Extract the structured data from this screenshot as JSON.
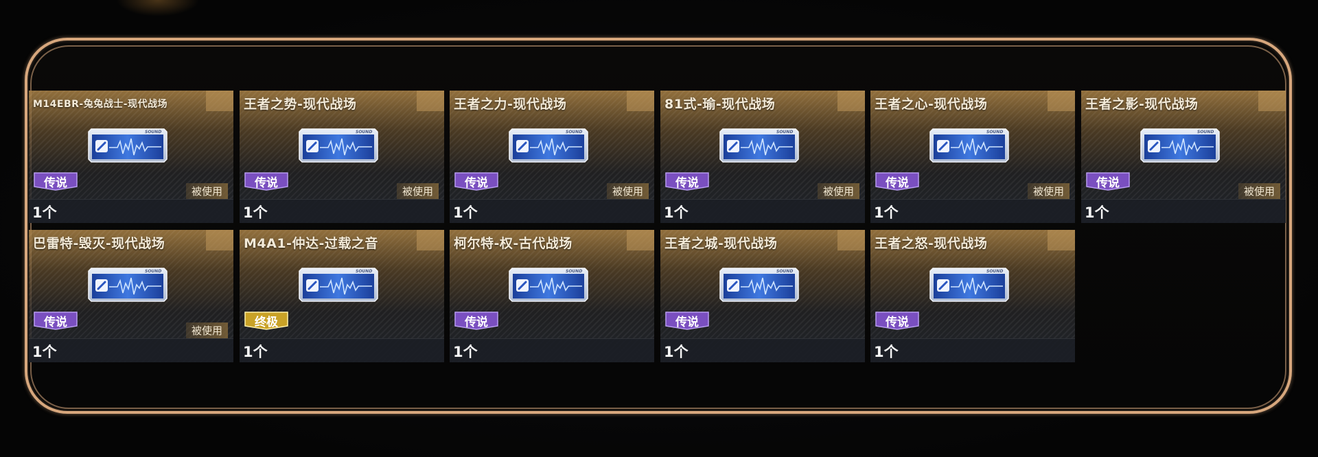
{
  "cards": [
    {
      "title": "M14EBR-兔兔战士-现代战场",
      "rarity": "传说",
      "rarity_color": "#7a4fc0",
      "status": "被使用",
      "count": "1个",
      "icon": "sound-ticket-icon"
    },
    {
      "title": "王者之势-现代战场",
      "rarity": "传说",
      "rarity_color": "#7a4fc0",
      "status": "被使用",
      "count": "1个",
      "icon": "sound-ticket-icon"
    },
    {
      "title": "王者之力-现代战场",
      "rarity": "传说",
      "rarity_color": "#7a4fc0",
      "status": "被使用",
      "count": "1个",
      "icon": "sound-ticket-icon"
    },
    {
      "title": "81式-瑜-现代战场",
      "rarity": "传说",
      "rarity_color": "#7a4fc0",
      "status": "被使用",
      "count": "1个",
      "icon": "sound-ticket-icon"
    },
    {
      "title": "王者之心-现代战场",
      "rarity": "传说",
      "rarity_color": "#7a4fc0",
      "status": "被使用",
      "count": "1个",
      "icon": "sound-ticket-icon"
    },
    {
      "title": "王者之影-现代战场",
      "rarity": "传说",
      "rarity_color": "#7a4fc0",
      "status": "被使用",
      "count": "1个",
      "icon": "sound-ticket-icon"
    },
    {
      "title": "巴雷特-毁灭-现代战场",
      "rarity": "传说",
      "rarity_color": "#7a4fc0",
      "status": "被使用",
      "count": "1个",
      "icon": "sound-ticket-icon"
    },
    {
      "title": "M4A1-仲达-过载之音",
      "rarity": "终极",
      "rarity_color": "#c9a227",
      "status": "",
      "count": "1个",
      "icon": "sound-ticket-icon"
    },
    {
      "title": "柯尔特-权-古代战场",
      "rarity": "传说",
      "rarity_color": "#7a4fc0",
      "status": "",
      "count": "1个",
      "icon": "sound-ticket-icon"
    },
    {
      "title": "王者之城-现代战场",
      "rarity": "传说",
      "rarity_color": "#7a4fc0",
      "status": "",
      "count": "1个",
      "icon": "sound-ticket-icon"
    },
    {
      "title": "王者之怒-现代战场",
      "rarity": "传说",
      "rarity_color": "#7a4fc0",
      "status": "",
      "count": "1个",
      "icon": "sound-ticket-icon"
    }
  ],
  "ticket_label": "SOUND",
  "colors": {
    "frame_border": "#d7a77d",
    "card_gold": "#aa8246",
    "legend_purple": "#7a4fc0",
    "ultimate_gold": "#c9a227"
  }
}
